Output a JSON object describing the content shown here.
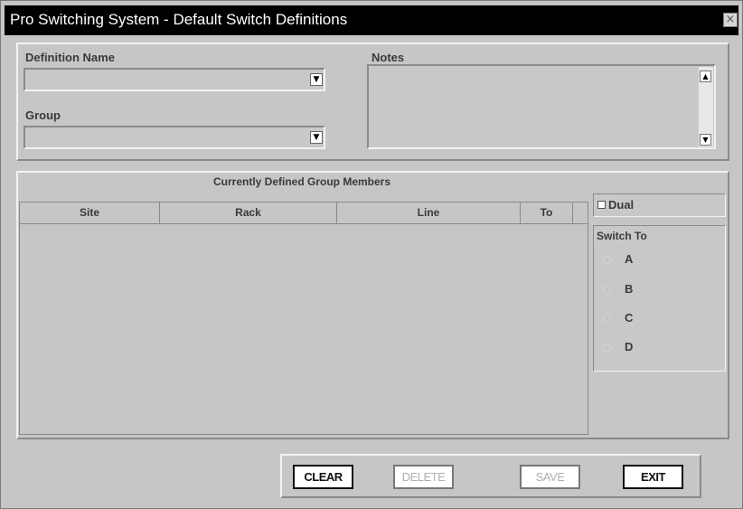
{
  "window": {
    "title": "Pro Switching System - Default Switch Definitions",
    "close_glyph": "×"
  },
  "form": {
    "definition_name_label": "Definition Name",
    "definition_name_value": "",
    "group_label": "Group",
    "group_value": "",
    "notes_label": "Notes",
    "notes_value": "",
    "dropdown_glyph": "▼"
  },
  "members": {
    "title": "Currently Defined Group Members",
    "columns": [
      "Site",
      "Rack",
      "Line",
      "To"
    ],
    "rows": []
  },
  "dual": {
    "label": "Dual",
    "checked": false
  },
  "switch_to": {
    "label": "Switch To",
    "options": [
      "A",
      "B",
      "C",
      "D"
    ],
    "selected": null
  },
  "buttons": {
    "clear": "CLEAR",
    "delete": "DELETE",
    "save": "SAVE",
    "exit": "EXIT"
  },
  "scroll": {
    "up_glyph": "▲",
    "down_glyph": "▼"
  }
}
